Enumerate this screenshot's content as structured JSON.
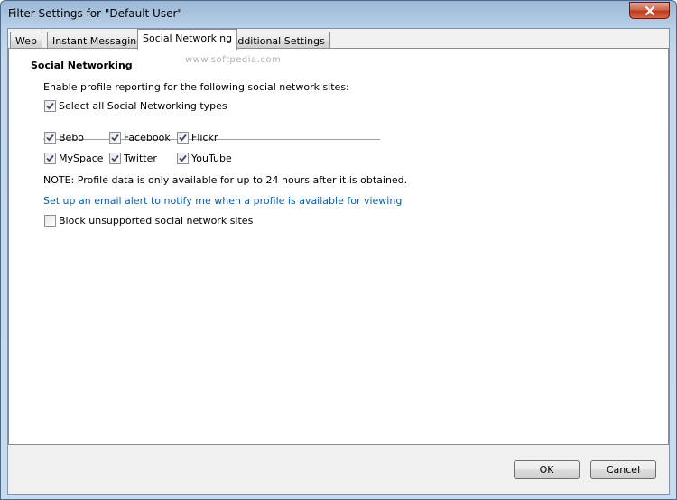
{
  "window": {
    "title": "Filter Settings for \"Default User\""
  },
  "tabs": [
    {
      "label": "Web",
      "active": false
    },
    {
      "label": "Instant Messaging",
      "active": false
    },
    {
      "label": "Social Networking",
      "active": true
    },
    {
      "label": "Additional Settings",
      "active": false
    }
  ],
  "panel": {
    "watermark": "www.softpedia.com",
    "section_title": "Social Networking",
    "intro": "Enable profile reporting for the following social network sites:",
    "select_all": {
      "label": "Select all Social Networking types",
      "checked": true
    },
    "sites": [
      {
        "label": "Bebo",
        "checked": true
      },
      {
        "label": "Facebook",
        "checked": true
      },
      {
        "label": "Flickr",
        "checked": true
      },
      {
        "label": "MySpace",
        "checked": true
      },
      {
        "label": "Twitter",
        "checked": true
      },
      {
        "label": "YouTube",
        "checked": true
      }
    ],
    "note": "NOTE: Profile data is only available for up to 24 hours after it is obtained.",
    "alert_link": "Set up an email alert to notify me when a profile is available for viewing",
    "block_unsupported": {
      "label": "Block unsupported social network sites",
      "checked": false
    }
  },
  "buttons": {
    "ok": "OK",
    "cancel": "Cancel"
  },
  "colors": {
    "link": "#0b5cad",
    "titlebar": "#b9d0e6",
    "close_button": "#c0391d"
  }
}
